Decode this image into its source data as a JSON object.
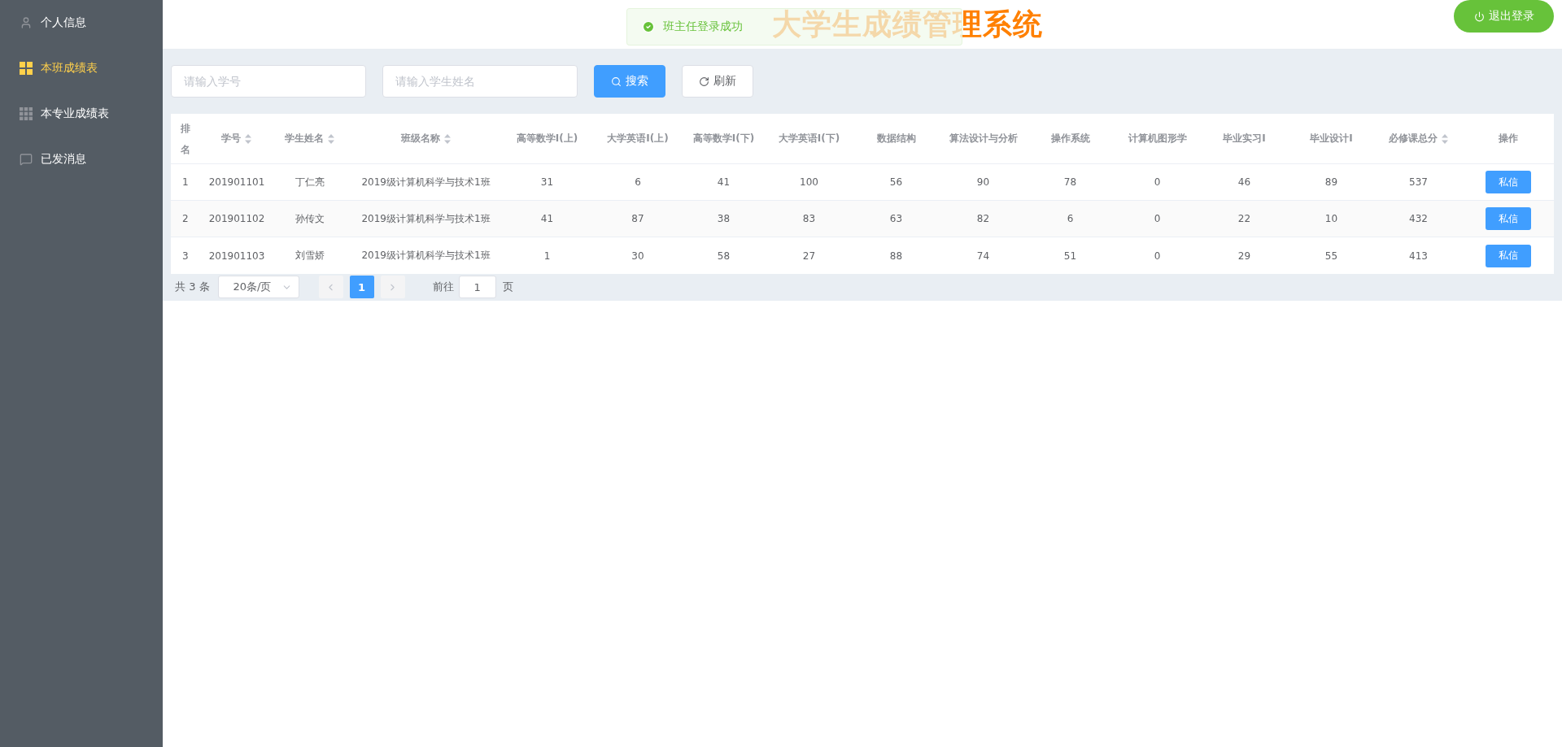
{
  "sidebar": {
    "items": [
      {
        "label": "个人信息",
        "selected": false
      },
      {
        "label": "本班成绩表",
        "selected": true
      },
      {
        "label": "本专业成绩表",
        "selected": false
      },
      {
        "label": "已发消息",
        "selected": false
      }
    ]
  },
  "header": {
    "title_main": "大学生成绩管理系",
    "title_end": "统",
    "logout_button": "退出登录"
  },
  "toast": {
    "message": "班主任登录成功"
  },
  "search": {
    "id_placeholder": "请输入学号",
    "name_placeholder": "请输入学生姓名",
    "search_button": "搜索",
    "refresh_button": "刷新"
  },
  "table": {
    "columns": [
      {
        "label": "排名",
        "sortable": false
      },
      {
        "label": "学号",
        "sortable": true
      },
      {
        "label": "学生姓名",
        "sortable": true
      },
      {
        "label": "班级名称",
        "sortable": true
      },
      {
        "label": "高等数学I(上)",
        "sortable": false
      },
      {
        "label": "大学英语I(上)",
        "sortable": false
      },
      {
        "label": "高等数学I(下)",
        "sortable": false
      },
      {
        "label": "大学英语I(下)",
        "sortable": false
      },
      {
        "label": "数据结构",
        "sortable": false
      },
      {
        "label": "算法设计与分析",
        "sortable": false
      },
      {
        "label": "操作系统",
        "sortable": false
      },
      {
        "label": "计算机图形学",
        "sortable": false
      },
      {
        "label": "毕业实习I",
        "sortable": false
      },
      {
        "label": "毕业设计I",
        "sortable": false
      },
      {
        "label": "必修课总分",
        "sortable": true
      },
      {
        "label": "操作",
        "sortable": false
      }
    ],
    "rows": [
      {
        "cells": [
          "1",
          "201901101",
          "丁仁亮",
          "2019级计算机科学与技术1班",
          "31",
          "6",
          "41",
          "100",
          "56",
          "90",
          "78",
          "0",
          "46",
          "89",
          "537"
        ],
        "action": "私信"
      },
      {
        "cells": [
          "2",
          "201901102",
          "孙传文",
          "2019级计算机科学与技术1班",
          "41",
          "87",
          "38",
          "83",
          "63",
          "82",
          "6",
          "0",
          "22",
          "10",
          "432"
        ],
        "action": "私信"
      },
      {
        "cells": [
          "3",
          "201901103",
          "刘雪娇",
          "2019级计算机科学与技术1班",
          "1",
          "30",
          "58",
          "27",
          "88",
          "74",
          "51",
          "0",
          "29",
          "55",
          "413"
        ],
        "action": "私信"
      }
    ]
  },
  "pagination": {
    "total": "共 3 条",
    "page_size": "20条/页",
    "prev_disabled": true,
    "next_disabled": true,
    "pages": [
      {
        "label": "1",
        "selected": true
      }
    ],
    "goto_label": "前往",
    "goto_value": "1",
    "goto_suffix": "页"
  }
}
